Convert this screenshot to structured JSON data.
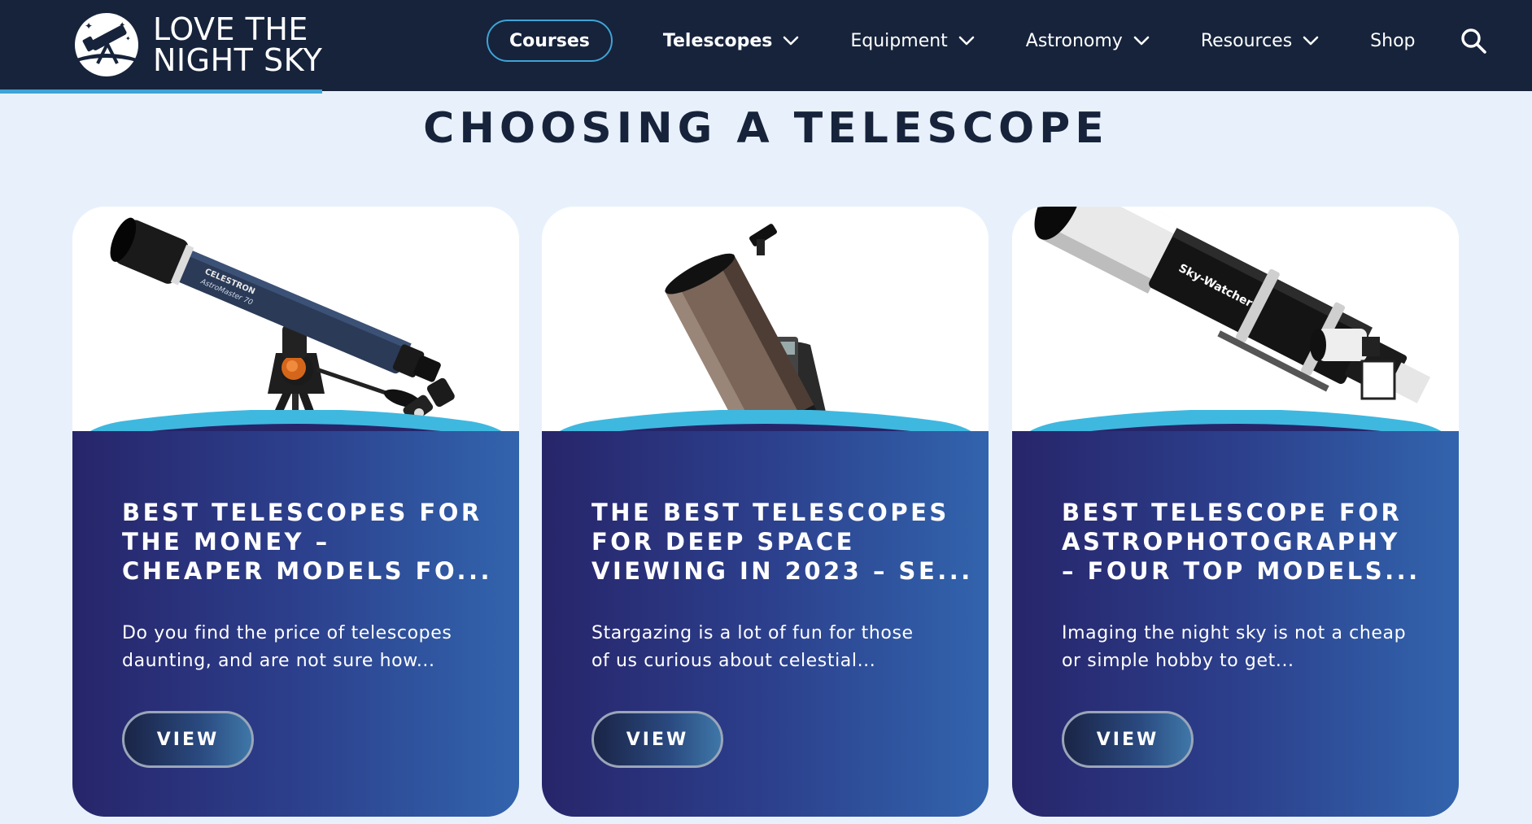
{
  "header": {
    "logo_line1": "LOVE THE",
    "logo_line2": "NIGHT SKY",
    "nav": {
      "courses": "Courses",
      "telescopes": "Telescopes",
      "equipment": "Equipment",
      "astronomy": "Astronomy",
      "resources": "Resources",
      "shop": "Shop"
    },
    "icons": {
      "logo": "telescope-logo-icon",
      "dropdown": "chevron-down-icon",
      "search": "search-icon"
    },
    "colors": {
      "bar": "#16233b",
      "accent": "#3fa3d6"
    }
  },
  "section": {
    "heading": "CHOOSING A TELESCOPE"
  },
  "cards": [
    {
      "title_lines": [
        "BEST TELESCOPES FOR",
        "THE MONEY –",
        "CHEAPER MODELS FO..."
      ],
      "excerpt_lines": [
        "Do you find the price of telescopes",
        "daunting, and are not sure how..."
      ],
      "button": "VIEW",
      "image_brand": "CELESTRON",
      "image_model": "AstroMaster 70"
    },
    {
      "title_lines": [
        "THE BEST TELESCOPES",
        "FOR DEEP SPACE",
        "VIEWING IN 2023 – SE..."
      ],
      "excerpt_lines": [
        "Stargazing is a lot of fun for those",
        "of us curious about celestial..."
      ],
      "button": "VIEW"
    },
    {
      "title_lines": [
        "BEST TELESCOPE FOR",
        "ASTROPHOTOGRAPHY",
        "– FOUR TOP MODELS..."
      ],
      "excerpt_lines": [
        "Imaging the night sky is not a cheap",
        "or simple hobby to get..."
      ],
      "button": "VIEW",
      "image_brand": "Sky-Watcher"
    }
  ],
  "colors": {
    "page_bg": "#e8f1fb",
    "card_gradient_start": "#27256a",
    "card_gradient_end": "#3264ad",
    "card_arc": "#3fb8e0"
  }
}
